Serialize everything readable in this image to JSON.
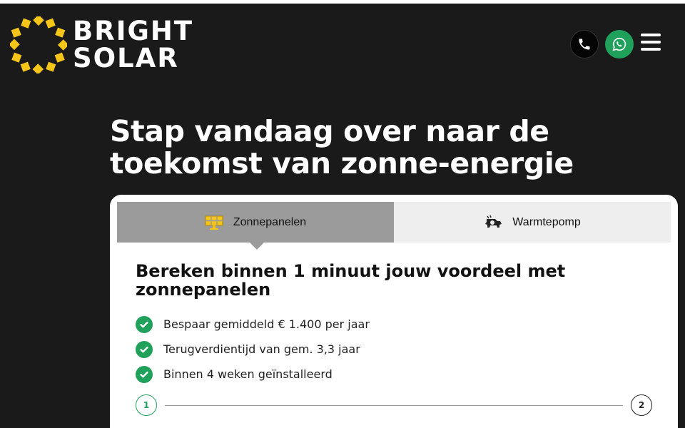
{
  "brand": {
    "line1": "BRIGHT",
    "line2": "SOLAR",
    "sun_color": "#f5c518"
  },
  "header": {
    "phone_icon": "phone-icon",
    "whatsapp_icon": "whatsapp-icon",
    "menu_icon": "hamburger-menu-icon"
  },
  "hero": {
    "title": "Stap vandaag over naar de toekomst van zonne-energie"
  },
  "tabs": [
    {
      "label": "Zonnepanelen",
      "icon": "solar-panel-icon",
      "active": true
    },
    {
      "label": "Warmtepomp",
      "icon": "heat-pump-icon",
      "active": false
    }
  ],
  "calculator": {
    "title": "Bereken binnen 1 minuut jouw voordeel met zonnepanelen",
    "benefits": [
      "Bespaar gemiddeld € 1.400 per jaar",
      "Terugverdientijd van gem. 3,3 jaar",
      "Binnen 4 weken geïnstalleerd"
    ],
    "steps": [
      "1",
      "2"
    ],
    "current_step": 1
  },
  "colors": {
    "background": "#1b1a1a",
    "accent_green": "#20a15b",
    "tab_active": "#9b9b9b",
    "tab_inactive": "#eeeeee"
  }
}
